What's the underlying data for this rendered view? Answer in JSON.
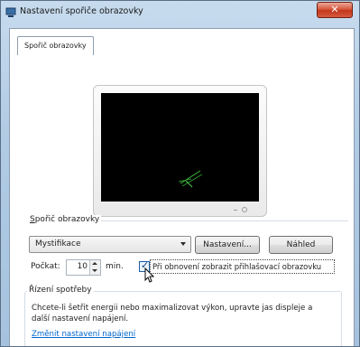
{
  "window": {
    "title": "Nastavení spořiče obrazovky",
    "close_label": "✕"
  },
  "tabs": [
    {
      "label": "Spořič obrazovky",
      "selected": true
    }
  ],
  "preview": {
    "icon": "monitor-preview"
  },
  "screensaver_group": {
    "label": "Spořič obrazovky",
    "selected_option": "Mystifikace",
    "settings_button": "Nastavení...",
    "preview_button": "Náhled",
    "wait_label": "Počkat:",
    "wait_value": "10",
    "wait_unit": "min.",
    "resume_checkbox_checked": true,
    "resume_label": "Při obnovení zobrazit přihlašovací obrazovku"
  },
  "power_group": {
    "label": "Řízení spotřeby",
    "description": "Chcete-li šetřit energii nebo maximalizovat výkon, upravte jas displeje a další nastavení napájení.",
    "link": "Změnit nastavení napájení"
  },
  "colors": {
    "window_frame": "#b1cbe4",
    "close_button": "#c2371b",
    "link": "#0066cc",
    "screen": "#000000",
    "screensaver_line": "#3fbf3f"
  }
}
